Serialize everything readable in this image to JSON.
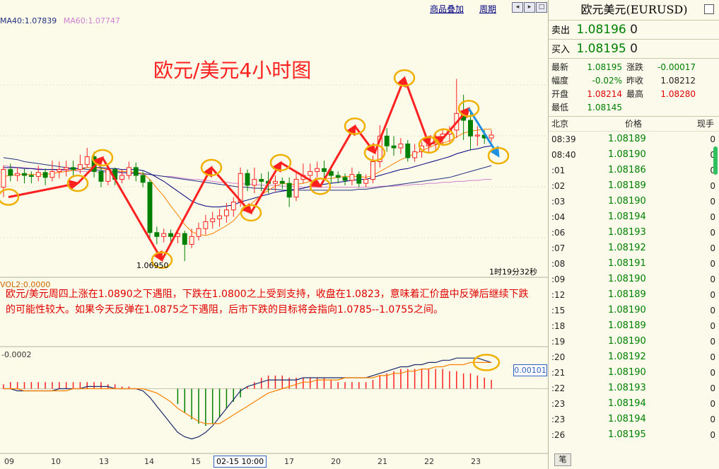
{
  "toolbar": {
    "overlay_label": "商品叠加",
    "period_label": "周期",
    "nav_icons": [
      "prev-icon",
      "next-icon",
      "maximize-icon"
    ]
  },
  "ma_legend": {
    "ma40": "MA40:1.07839",
    "ma60": "MA60:1.07747"
  },
  "chart_title": "欧元/美元4小时图",
  "low_label": "1.06950",
  "countdown": "1时19分32秒",
  "vol_label": "VOL2:0.0000",
  "news_text": "欧元/美元周四上涨在1.0890之下遇阻，下跌在1.0800之上受到支持，收盘在1.0823，意味着汇价盘中反弹后继续下跌的可能性较大。如果今天反弹在1.0875之下遇阻，后市下跌的目标将会指向1.0785--1.0755之间。",
  "macd_label": "-0.0002",
  "macd_value": "0.00101",
  "cursor_date": "02-15 10:00",
  "x_labels": [
    "09",
    "10",
    "13",
    "14",
    "15",
    "17",
    "20",
    "21",
    "22",
    "23"
  ],
  "colors": {
    "up": "#ff2020",
    "down": "#008000",
    "ma_short": "#ff8000",
    "ma_mid": "#000080",
    "ma40": "#203080",
    "ma60": "#d080d0",
    "annotation": "#ff2020",
    "forecast": "#2090e0",
    "circle": "#f0b000"
  },
  "quote": {
    "title": "欧元美元(EURUSD)",
    "sell_label": "卖出",
    "sell_price": "1.08196",
    "sell_qty": "0",
    "buy_label": "买入",
    "buy_price": "1.08195",
    "buy_qty": "0",
    "stats": [
      {
        "l1": "最新",
        "v1": "1.08195",
        "l2": "涨跌",
        "v2": "-0.00017",
        "c1": "#008000",
        "c2": "#008000"
      },
      {
        "l1": "幅度",
        "v1": "-0.02%",
        "l2": "昨收",
        "v2": "1.08212",
        "c1": "#008000",
        "c2": "#222"
      },
      {
        "l1": "开盘",
        "v1": "1.08214",
        "l2": "最高",
        "v2": "1.08280",
        "c1": "#e00000",
        "c2": "#e00000"
      },
      {
        "l1": "最低",
        "v1": "1.08145",
        "l2": "",
        "v2": "",
        "c1": "#008000",
        "c2": "#222"
      }
    ],
    "ticks_header": {
      "time": "北京",
      "price": "价格",
      "qty": "现手"
    },
    "ticks": [
      {
        "t": "08:39",
        "p": "1.08189",
        "q": "0"
      },
      {
        "t": "08:40",
        "p": "1.08190",
        "q": "0"
      },
      {
        "t": ":01",
        "p": "1.08186",
        "q": "0"
      },
      {
        "t": ":02",
        "p": "1.08189",
        "q": "0"
      },
      {
        "t": ":03",
        "p": "1.08190",
        "q": "0"
      },
      {
        "t": ":04",
        "p": "1.08194",
        "q": "0"
      },
      {
        "t": ":06",
        "p": "1.08193",
        "q": "0"
      },
      {
        "t": ":07",
        "p": "1.08192",
        "q": "0"
      },
      {
        "t": ":08",
        "p": "1.08191",
        "q": "0"
      },
      {
        "t": ":09",
        "p": "1.08190",
        "q": "0"
      },
      {
        "t": ":12",
        "p": "1.08189",
        "q": "0"
      },
      {
        "t": ":15",
        "p": "1.08190",
        "q": "0"
      },
      {
        "t": ":18",
        "p": "1.08189",
        "q": "0"
      },
      {
        "t": ":19",
        "p": "1.08190",
        "q": "0"
      },
      {
        "t": ":20",
        "p": "1.08192",
        "q": "0"
      },
      {
        "t": ":21",
        "p": "1.08190",
        "q": "0"
      },
      {
        "t": ":22",
        "p": "1.08193",
        "q": "0"
      },
      {
        "t": ":23",
        "p": "1.08194",
        "q": "0"
      },
      {
        "t": ":23",
        "p": "1.08194",
        "q": "0"
      },
      {
        "t": ":26",
        "p": "1.08195",
        "q": "0"
      }
    ],
    "tab_label": "笔"
  },
  "chart_data": {
    "type": "candlestick",
    "title": "欧元/美元4小时图",
    "ylim": [
      1.068,
      1.0935
    ],
    "candles": [
      [
        1.077,
        1.0788,
        1.076,
        1.0792
      ],
      [
        1.0788,
        1.0782,
        1.0776,
        1.0794
      ],
      [
        1.0782,
        1.0784,
        1.0776,
        1.079
      ],
      [
        1.0784,
        1.0782,
        1.0774,
        1.0789
      ],
      [
        1.0782,
        1.0781,
        1.0774,
        1.0786
      ],
      [
        1.0781,
        1.0785,
        1.0776,
        1.0792
      ],
      [
        1.0785,
        1.078,
        1.0772,
        1.0789
      ],
      [
        1.078,
        1.0786,
        1.0776,
        1.0797
      ],
      [
        1.0786,
        1.0788,
        1.0779,
        1.0796
      ],
      [
        1.0788,
        1.079,
        1.0781,
        1.0797
      ],
      [
        1.079,
        1.0788,
        1.078,
        1.0797
      ],
      [
        1.0788,
        1.0793,
        1.0784,
        1.0803
      ],
      [
        1.0793,
        1.0801,
        1.079,
        1.081
      ],
      [
        1.0801,
        1.0786,
        1.078,
        1.0806
      ],
      [
        1.0786,
        1.0776,
        1.077,
        1.079
      ],
      [
        1.0776,
        1.0788,
        1.0772,
        1.0793
      ],
      [
        1.0788,
        1.0778,
        1.0772,
        1.079
      ],
      [
        1.0778,
        1.0782,
        1.0774,
        1.0788
      ],
      [
        1.0782,
        1.079,
        1.0778,
        1.0796
      ],
      [
        1.079,
        1.0782,
        1.0776,
        1.0795
      ],
      [
        1.0782,
        1.0775,
        1.077,
        1.0786
      ],
      [
        1.0775,
        1.0724,
        1.0718,
        1.0778
      ],
      [
        1.0724,
        1.072,
        1.0712,
        1.073
      ],
      [
        1.072,
        1.0723,
        1.0714,
        1.0728
      ],
      [
        1.0723,
        1.072,
        1.0713,
        1.0727
      ],
      [
        1.072,
        1.0723,
        1.0713,
        1.0728
      ],
      [
        1.0723,
        1.0712,
        1.0695,
        1.0726
      ],
      [
        1.0712,
        1.072,
        1.0708,
        1.0728
      ],
      [
        1.072,
        1.0728,
        1.0716,
        1.0734
      ],
      [
        1.0728,
        1.0735,
        1.0722,
        1.0742
      ],
      [
        1.0735,
        1.0738,
        1.0728,
        1.0745
      ],
      [
        1.0738,
        1.0741,
        1.073,
        1.0748
      ],
      [
        1.0741,
        1.0747,
        1.0734,
        1.0754
      ],
      [
        1.0747,
        1.0755,
        1.074,
        1.076
      ],
      [
        1.0755,
        1.0784,
        1.075,
        1.079
      ],
      [
        1.0784,
        1.0772,
        1.0766,
        1.0788
      ],
      [
        1.0772,
        1.0778,
        1.0764,
        1.079
      ],
      [
        1.0778,
        1.0776,
        1.0766,
        1.0784
      ],
      [
        1.0776,
        1.0774,
        1.0764,
        1.0786
      ],
      [
        1.0774,
        1.0776,
        1.0766,
        1.0782
      ],
      [
        1.0776,
        1.0774,
        1.0768,
        1.078
      ],
      [
        1.0774,
        1.076,
        1.075,
        1.078
      ],
      [
        1.076,
        1.0778,
        1.0756,
        1.0786
      ],
      [
        1.0778,
        1.0782,
        1.0774,
        1.0794
      ],
      [
        1.0782,
        1.0786,
        1.0778,
        1.0794
      ],
      [
        1.0786,
        1.0789,
        1.078,
        1.0796
      ],
      [
        1.0789,
        1.0786,
        1.0778,
        1.0797
      ],
      [
        1.0786,
        1.0782,
        1.0774,
        1.079
      ],
      [
        1.0782,
        1.078,
        1.0774,
        1.0786
      ],
      [
        1.078,
        1.0777,
        1.0772,
        1.0784
      ],
      [
        1.0777,
        1.0783,
        1.0772,
        1.079
      ],
      [
        1.0783,
        1.0774,
        1.077,
        1.0786
      ],
      [
        1.0774,
        1.0778,
        1.077,
        1.0783
      ],
      [
        1.0778,
        1.0796,
        1.0774,
        1.0802
      ],
      [
        1.0796,
        1.0822,
        1.079,
        1.0833
      ],
      [
        1.0822,
        1.0812,
        1.0806,
        1.083
      ],
      [
        1.0812,
        1.081,
        1.0802,
        1.0822
      ],
      [
        1.081,
        1.0814,
        1.0804,
        1.082
      ],
      [
        1.0814,
        1.08,
        1.0796,
        1.0818
      ],
      [
        1.08,
        1.0806,
        1.0796,
        1.0814
      ],
      [
        1.0806,
        1.0812,
        1.08,
        1.0816
      ],
      [
        1.0812,
        1.0814,
        1.0806,
        1.082
      ],
      [
        1.0814,
        1.082,
        1.0808,
        1.0826
      ],
      [
        1.082,
        1.0824,
        1.0812,
        1.083
      ],
      [
        1.0824,
        1.0828,
        1.0816,
        1.0832
      ],
      [
        1.0828,
        1.0845,
        1.082,
        1.088
      ],
      [
        1.0845,
        1.0838,
        1.0818,
        1.0864
      ],
      [
        1.0838,
        1.0822,
        1.0808,
        1.0848
      ],
      [
        1.0822,
        1.0823,
        1.0812,
        1.0832
      ],
      [
        1.0823,
        1.082,
        1.0814,
        1.0828
      ],
      [
        1.082,
        1.0823,
        1.0816,
        1.0828
      ]
    ],
    "ma_short": [
      1.0781,
      1.0782,
      1.0783,
      1.0783,
      1.0783,
      1.0783,
      1.0783,
      1.0784,
      1.0785,
      1.0786,
      1.0787,
      1.0788,
      1.079,
      1.079,
      1.0789,
      1.0788,
      1.0787,
      1.0786,
      1.0786,
      1.0785,
      1.0784,
      1.0778,
      1.0769,
      1.0761,
      1.0751,
      1.0742,
      1.0732,
      1.0725,
      1.0722,
      1.0721,
      1.0723,
      1.0727,
      1.0731,
      1.0736,
      1.0744,
      1.075,
      1.0756,
      1.0762,
      1.0767,
      1.0771,
      1.0774,
      1.0773,
      1.0773,
      1.0774,
      1.0776,
      1.0778,
      1.0779,
      1.0779,
      1.078,
      1.0781,
      1.0781,
      1.0781,
      1.078,
      1.0782,
      1.0786,
      1.079,
      1.0794,
      1.0798,
      1.0801,
      1.0804,
      1.0807,
      1.081,
      1.0813,
      1.0815,
      1.0817,
      1.0821,
      1.0825,
      1.0827,
      1.0828,
      1.0829,
      1.0829
    ],
    "ma_mid": [
      1.079,
      1.079,
      1.079,
      1.0789,
      1.0789,
      1.0788,
      1.0788,
      1.0788,
      1.0788,
      1.0788,
      1.0789,
      1.0789,
      1.079,
      1.079,
      1.079,
      1.0789,
      1.0789,
      1.0788,
      1.0788,
      1.0788,
      1.0787,
      1.0784,
      1.078,
      1.0776,
      1.0771,
      1.0766,
      1.0761,
      1.0756,
      1.0753,
      1.0751,
      1.075,
      1.075,
      1.0751,
      1.0752,
      1.0755,
      1.0757,
      1.0759,
      1.0761,
      1.0763,
      1.0765,
      1.0766,
      1.0767,
      1.0768,
      1.0769,
      1.0771,
      1.0772,
      1.0773,
      1.0774,
      1.0775,
      1.0776,
      1.0777,
      1.0778,
      1.0778,
      1.078,
      1.0782,
      1.0784,
      1.0786,
      1.0788,
      1.0789,
      1.0791,
      1.0793,
      1.0795,
      1.0797,
      1.0799,
      1.0801,
      1.0804,
      1.0806,
      1.0808,
      1.0809,
      1.0811,
      1.0812
    ],
    "ma40": [
      1.08,
      1.0799,
      1.0798,
      1.0796,
      1.0795,
      1.0794,
      1.0793,
      1.0792,
      1.0791,
      1.079,
      1.0789,
      1.0789,
      1.0788,
      1.0788,
      1.0787,
      1.0786,
      1.0786,
      1.0785,
      1.0785,
      1.0784,
      1.0784,
      1.0783,
      1.0782,
      1.0781,
      1.078,
      1.0779,
      1.0778,
      1.0777,
      1.0776,
      1.0775,
      1.0774,
      1.0773,
      1.0772,
      1.0771,
      1.077,
      1.077,
      1.0769,
      1.0769,
      1.0768,
      1.0768,
      1.0767,
      1.0767,
      1.0767,
      1.0767,
      1.0767,
      1.0767,
      1.0767,
      1.0767,
      1.0767,
      1.0767,
      1.0767,
      1.0768,
      1.0768,
      1.0769,
      1.077,
      1.0771,
      1.0772,
      1.0773,
      1.0774,
      1.0775,
      1.0776,
      1.0777,
      1.0778,
      1.0779,
      1.078,
      1.0782,
      1.0784,
      1.0786,
      1.0788,
      1.079,
      1.0792
    ],
    "ma60": [
      1.0792,
      1.0791,
      1.079,
      1.079,
      1.0789,
      1.0789,
      1.0788,
      1.0788,
      1.0787,
      1.0787,
      1.0787,
      1.0786,
      1.0786,
      1.0786,
      1.0785,
      1.0785,
      1.0785,
      1.0784,
      1.0784,
      1.0784,
      1.0783,
      1.0783,
      1.0782,
      1.0781,
      1.0781,
      1.078,
      1.0779,
      1.0778,
      1.0778,
      1.0777,
      1.0776,
      1.0775,
      1.0775,
      1.0774,
      1.0774,
      1.0773,
      1.0773,
      1.0772,
      1.0772,
      1.0772,
      1.0771,
      1.0771,
      1.0771,
      1.077,
      1.077,
      1.077,
      1.077,
      1.077,
      1.077,
      1.077,
      1.077,
      1.077,
      1.077,
      1.077,
      1.0771,
      1.0771,
      1.0771,
      1.0772,
      1.0772,
      1.0773,
      1.0773,
      1.0774,
      1.0774,
      1.0775,
      1.0775,
      1.0776,
      1.0776,
      1.0777,
      1.0777,
      1.0778,
      1.0778
    ],
    "annotation_points": [
      [
        0,
        1.076
      ],
      [
        14,
        1.0774
      ],
      [
        19,
        1.08
      ],
      [
        31,
        1.0696
      ],
      [
        41,
        1.079
      ],
      [
        49,
        1.0744
      ],
      [
        55,
        1.0795
      ],
      [
        63,
        1.0771
      ],
      [
        70,
        1.0832
      ],
      [
        74,
        1.0805
      ],
      [
        80,
        1.0881
      ],
      [
        85,
        1.0813
      ],
      [
        88,
        1.0821
      ],
      [
        93,
        1.085
      ],
      [
        99,
        1.0802
      ]
    ],
    "macd": {
      "ylim": [
        -0.0028,
        0.0016
      ],
      "hist": [
        0.0002,
        0.0003,
        0.0003,
        0.0003,
        0.0003,
        0.0003,
        0.0003,
        0.0003,
        0.0003,
        0.0003,
        0.0003,
        0.0003,
        0.0003,
        0.0003,
        0.0003,
        0.0002,
        0.0002,
        0.0001,
        0.0001,
        0.0,
        0,
        0,
        0,
        0,
        0,
        -0.0007,
        -0.0011,
        -0.0014,
        -0.0016,
        -0.0017,
        -0.0016,
        -0.0013,
        -0.0009,
        -0.0006,
        -0.0004,
        0.0001,
        0.0003,
        0.0005,
        0.0006,
        0.0006,
        0.0006,
        0.0005,
        0.0005,
        0.0005,
        0.0005,
        0.0005,
        0.0005,
        0.0004,
        0.0003,
        0.0003,
        0.0003,
        0.0003,
        0.0003,
        0.0004,
        0.0006,
        0.0007,
        0.0008,
        0.0009,
        0.0009,
        0.0009,
        0.0009,
        0.0009,
        0.0009,
        0.0009,
        0.0008,
        0.0008,
        0.0007,
        0.0007,
        0.0006,
        0.0005,
        0.0004
      ],
      "dif": [
        0.0,
        0.0,
        -0.0001,
        -0.0001,
        -0.0001,
        -0.0001,
        -0.0001,
        -0.0001,
        0.0,
        0.0,
        0.0,
        0.0,
        0.0001,
        0.0001,
        0.0001,
        0.0001,
        0.0,
        0.0,
        0.0,
        0.0,
        -0.0001,
        -0.0004,
        -0.0008,
        -0.0012,
        -0.0016,
        -0.002,
        -0.0022,
        -0.0023,
        -0.0022,
        -0.002,
        -0.0017,
        -0.0013,
        -0.0009,
        -0.0005,
        -0.0001,
        0.0001,
        0.0002,
        0.0003,
        0.0004,
        0.0004,
        0.0004,
        0.0004,
        0.0004,
        0.0005,
        0.0005,
        0.0005,
        0.0005,
        0.0005,
        0.0005,
        0.0005,
        0.0005,
        0.0005,
        0.0005,
        0.0006,
        0.0007,
        0.0008,
        0.0009,
        0.001,
        0.001,
        0.0011,
        0.0011,
        0.0012,
        0.0012,
        0.0013,
        0.0013,
        0.0014,
        0.0014,
        0.0014,
        0.0014,
        0.0013,
        0.0012
      ],
      "dea": [
        0.0,
        0.0,
        0.0,
        -0.0001,
        -0.0001,
        -0.0001,
        -0.0001,
        -0.0001,
        -0.0001,
        -0.0001,
        0.0,
        0.0,
        0.0,
        0.0,
        0.0,
        0.0,
        0.0,
        0.0,
        0.0,
        0.0,
        0.0,
        -0.0001,
        -0.0002,
        -0.0004,
        -0.0006,
        -0.0009,
        -0.0011,
        -0.0013,
        -0.0015,
        -0.0016,
        -0.0016,
        -0.0016,
        -0.0014,
        -0.0012,
        -0.001,
        -0.0008,
        -0.0006,
        -0.0004,
        -0.0002,
        -0.0001,
        0.0,
        0.0001,
        0.0002,
        0.0003,
        0.0003,
        0.0004,
        0.0004,
        0.0004,
        0.0004,
        0.0005,
        0.0005,
        0.0005,
        0.0005,
        0.0005,
        0.0006,
        0.0006,
        0.0007,
        0.0007,
        0.0008,
        0.0008,
        0.0009,
        0.0009,
        0.001,
        0.001,
        0.0011,
        0.0011,
        0.0011,
        0.0012,
        0.0012,
        0.0012,
        0.0012
      ]
    }
  }
}
